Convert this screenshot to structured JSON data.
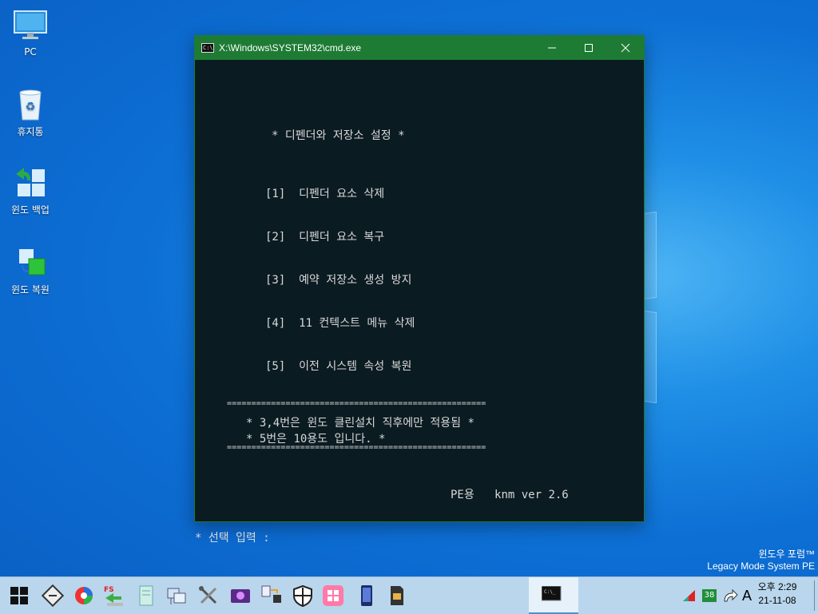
{
  "desktop": {
    "icons": [
      {
        "label": "PC",
        "icon": "computer-icon"
      },
      {
        "label": "휴지통",
        "icon": "recycle-bin-icon"
      },
      {
        "label": "윈도 백업",
        "icon": "backup-icon"
      },
      {
        "label": "윈도 복원",
        "icon": "restore-icon"
      }
    ],
    "watermark": {
      "line1": "윈도우 포럼™",
      "line2": "Legacy Mode System PE"
    }
  },
  "cmd_window": {
    "title": "X:\\Windows\\SYSTEM32\\cmd.exe",
    "heading": "* 디펜더와 저장소 설정 *",
    "options": [
      "[1]  디펜더 요소 삭제",
      "[2]  디펜더 요소 복구",
      "[3]  예약 저장소 생성 방지",
      "[4]  11 컨텍스트 메뉴 삭제",
      "[5]  이전 시스템 속성 복원"
    ],
    "separator": "=====================================================",
    "notes": [
      "* 3,4번은 윈도 클린설치 직후에만 적용됨 *",
      "* 5번은 10용도 입니다. *"
    ],
    "version": "PE용   knm ver 2.6",
    "prompt": "* 선택 입력 :"
  },
  "taskbar": {
    "tray_badge": "38",
    "ime": "A",
    "time": "오후 2:29",
    "date": "21-11-08"
  },
  "colors": {
    "title_bar": "#1e7b34",
    "console_bg": "#0b1b22",
    "taskbar": "#b9d6ec"
  }
}
